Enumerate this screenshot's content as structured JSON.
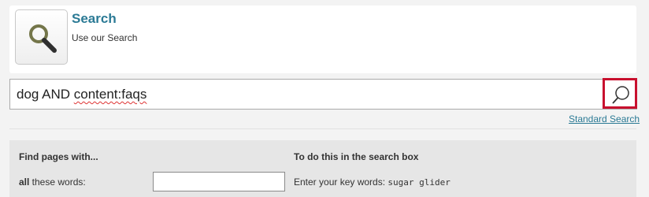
{
  "header": {
    "title": "Search",
    "subtitle": "Use our Search",
    "icon": "magnifier-icon"
  },
  "search": {
    "query_plain": "dog AND ",
    "query_flagged": "content:faqs",
    "button_icon": "search-icon",
    "accent_color": "#c8102e"
  },
  "links": {
    "standard_search": "Standard Search"
  },
  "help": {
    "left_heading": "Find pages with...",
    "right_heading": "To do this in the search box",
    "rows": [
      {
        "label_bold": "all",
        "label_rest": " these words:",
        "input_value": "",
        "instruction": "Enter your key words: ",
        "example": "sugar glider"
      }
    ]
  }
}
